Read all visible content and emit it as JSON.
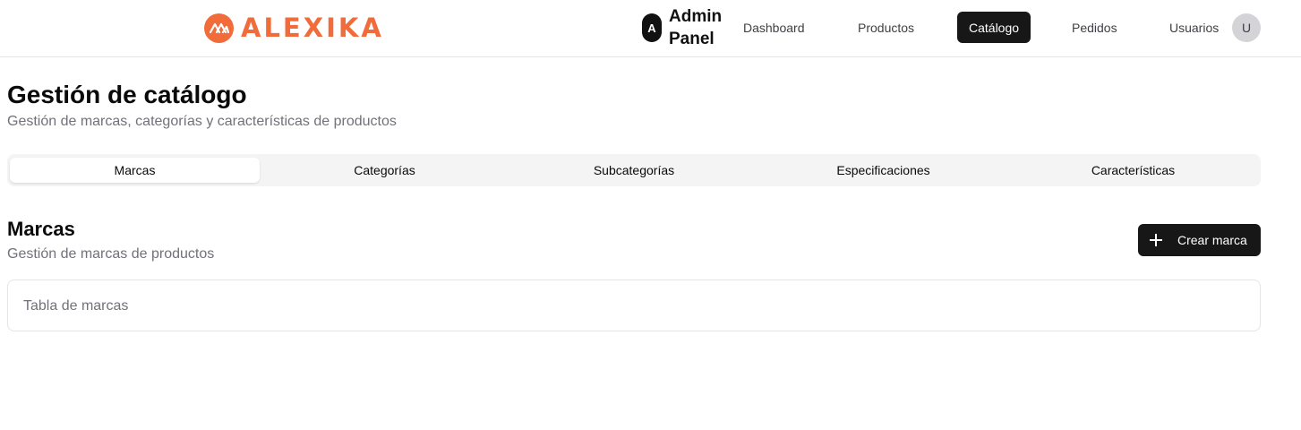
{
  "header": {
    "logo_text": "ALEXIKA",
    "brand_initial": "A",
    "brand_name": "Admin Panel",
    "nav": [
      {
        "label": "Dashboard",
        "active": false
      },
      {
        "label": "Productos",
        "active": false
      },
      {
        "label": "Catálogo",
        "active": true
      },
      {
        "label": "Pedidos",
        "active": false
      },
      {
        "label": "Usuarios",
        "active": false
      }
    ],
    "avatar_initial": "U"
  },
  "page": {
    "title": "Gestión de catálogo",
    "subtitle": "Gestión de marcas, categorías y características de productos"
  },
  "tabs": [
    {
      "label": "Marcas",
      "active": true
    },
    {
      "label": "Categorías",
      "active": false
    },
    {
      "label": "Subcategorías",
      "active": false
    },
    {
      "label": "Especificaciones",
      "active": false
    },
    {
      "label": "Características",
      "active": false
    }
  ],
  "section": {
    "title": "Marcas",
    "subtitle": "Gestión de marcas de productos",
    "create_button_label": "Crear marca",
    "table_placeholder": "Tabla de marcas"
  },
  "colors": {
    "brand_orange": "#f26b3a",
    "dark": "#171717",
    "muted_text": "#71717a"
  },
  "icons": {
    "logo": "alexika-logo-icon",
    "create": "plus-icon"
  }
}
